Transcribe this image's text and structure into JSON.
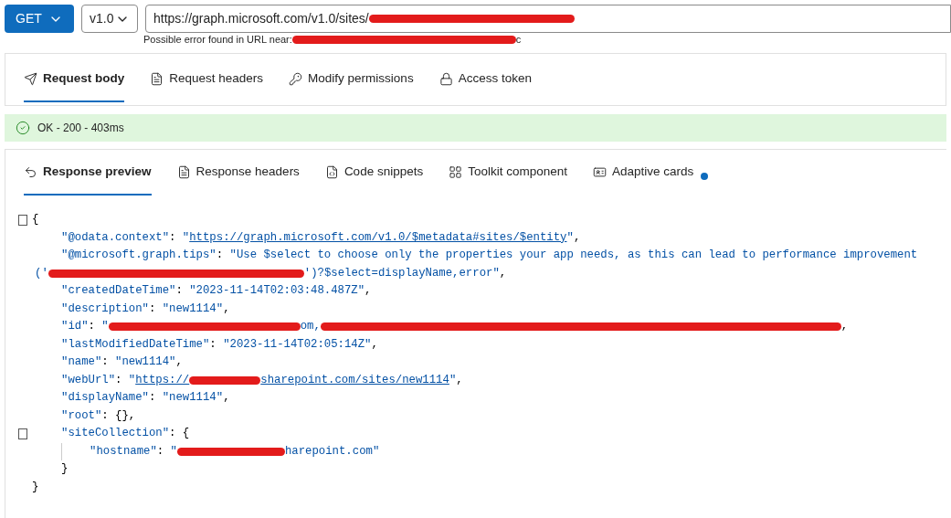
{
  "request": {
    "method": "GET",
    "version": "v1.0",
    "url": "https://graph.microsoft.com/v1.0/sites/",
    "url_error": {
      "label": "Possible error found in URL near:",
      "tail": "c"
    }
  },
  "request_tabs": [
    {
      "label": "Request body",
      "selected": true
    },
    {
      "label": "Request headers",
      "selected": false
    },
    {
      "label": "Modify permissions",
      "selected": false
    },
    {
      "label": "Access token",
      "selected": false
    }
  ],
  "status": {
    "text": "OK - 200 - 403ms",
    "kind": "success"
  },
  "response_tabs": [
    {
      "label": "Response preview",
      "selected": true
    },
    {
      "label": "Response headers",
      "selected": false
    },
    {
      "label": "Code snippets",
      "selected": false
    },
    {
      "label": "Toolkit component",
      "selected": false
    },
    {
      "label": "Adaptive cards",
      "selected": false,
      "badge": true
    }
  ],
  "code_lines": [
    {
      "fold": true,
      "segments": [
        {
          "kind": "punct",
          "text": "{"
        }
      ],
      "children": [
        {
          "segments": [
            {
              "kind": "key",
              "text": "\"@odata.context\""
            },
            {
              "kind": "punct",
              "text": ": "
            },
            {
              "kind": "string",
              "text": "\""
            },
            {
              "kind": "link",
              "text": "https://graph.microsoft.com/v1.0/$metadata#sites/$entity"
            },
            {
              "kind": "string",
              "text": "\""
            },
            {
              "kind": "punct",
              "text": ","
            }
          ]
        },
        {
          "segments": [
            {
              "kind": "key",
              "text": "\"@microsoft.graph.tips\""
            },
            {
              "kind": "punct",
              "text": ": "
            },
            {
              "kind": "string",
              "text": "\"Use $select to choose only the properties your app needs, as this can lead to performance improvement"
            }
          ]
        },
        {
          "continuation": true,
          "segments": [
            {
              "kind": "string",
              "text": "('"
            },
            {
              "kind": "redaction"
            },
            {
              "kind": "string",
              "text": "')?$select=displayName,error\""
            },
            {
              "kind": "punct",
              "text": ","
            }
          ]
        },
        {
          "segments": [
            {
              "kind": "key",
              "text": "\"createdDateTime\""
            },
            {
              "kind": "punct",
              "text": ": "
            },
            {
              "kind": "string",
              "text": "\"2023-11-14T02:03:48.487Z\""
            },
            {
              "kind": "punct",
              "text": ","
            }
          ]
        },
        {
          "segments": [
            {
              "kind": "key",
              "text": "\"description\""
            },
            {
              "kind": "punct",
              "text": ": "
            },
            {
              "kind": "string",
              "text": "\"new1114\""
            },
            {
              "kind": "punct",
              "text": ","
            }
          ]
        },
        {
          "segments": [
            {
              "kind": "key",
              "text": "\"id\""
            },
            {
              "kind": "punct",
              "text": ": "
            },
            {
              "kind": "string",
              "text": "\""
            },
            {
              "kind": "redaction"
            },
            {
              "kind": "string",
              "text": "om,"
            },
            {
              "kind": "redaction"
            },
            {
              "kind": "punct",
              "text": ","
            }
          ]
        },
        {
          "segments": [
            {
              "kind": "key",
              "text": "\"lastModifiedDateTime\""
            },
            {
              "kind": "punct",
              "text": ": "
            },
            {
              "kind": "string",
              "text": "\"2023-11-14T02:05:14Z\""
            },
            {
              "kind": "punct",
              "text": ","
            }
          ]
        },
        {
          "segments": [
            {
              "kind": "key",
              "text": "\"name\""
            },
            {
              "kind": "punct",
              "text": ": "
            },
            {
              "kind": "string",
              "text": "\"new1114\""
            },
            {
              "kind": "punct",
              "text": ","
            }
          ]
        },
        {
          "segments": [
            {
              "kind": "key",
              "text": "\"webUrl\""
            },
            {
              "kind": "punct",
              "text": ": "
            },
            {
              "kind": "string",
              "text": "\""
            },
            {
              "kind": "link",
              "text": "https://"
            },
            {
              "kind": "redaction"
            },
            {
              "kind": "link",
              "text": "sharepoint.com/sites/new1114"
            },
            {
              "kind": "string",
              "text": "\""
            },
            {
              "kind": "punct",
              "text": ","
            }
          ]
        },
        {
          "segments": [
            {
              "kind": "key",
              "text": "\"displayName\""
            },
            {
              "kind": "punct",
              "text": ": "
            },
            {
              "kind": "string",
              "text": "\"new1114\""
            },
            {
              "kind": "punct",
              "text": ","
            }
          ]
        },
        {
          "segments": [
            {
              "kind": "key",
              "text": "\"root\""
            },
            {
              "kind": "punct",
              "text": ": {},"
            }
          ]
        },
        {
          "fold": true,
          "segments": [
            {
              "kind": "key",
              "text": "\"siteCollection\""
            },
            {
              "kind": "punct",
              "text": ": {"
            }
          ],
          "children": [
            {
              "segments": [
                {
                  "kind": "key",
                  "text": "\"hostname\""
                },
                {
                  "kind": "punct",
                  "text": ": "
                },
                {
                  "kind": "string",
                  "text": "\""
                },
                {
                  "kind": "redaction"
                },
                {
                  "kind": "string",
                  "text": "harepoint.com\""
                }
              ]
            }
          ]
        },
        {
          "segments": [
            {
              "kind": "punct",
              "text": "}"
            }
          ]
        }
      ]
    },
    {
      "segments": [
        {
          "kind": "punct",
          "text": "}"
        }
      ]
    }
  ]
}
